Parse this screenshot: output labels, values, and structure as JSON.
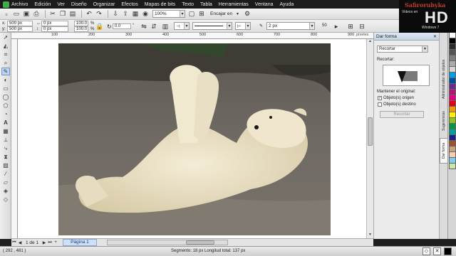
{
  "menubar": {
    "items": [
      "Archivo",
      "Edición",
      "Ver",
      "Diseño",
      "Organizar",
      "Efectos",
      "Mapas de bits",
      "Texto",
      "Tabla",
      "Herramientas",
      "Ventana",
      "Ayuda"
    ]
  },
  "std_toolbar": {
    "zoom": "100%",
    "snap": "Encajar en"
  },
  "property_bar": {
    "x": "500 px",
    "y": "500 px",
    "w": "0 px",
    "h": "0 px",
    "scale_w": "100.0",
    "scale_h": "100.0",
    "angle": "0.0",
    "outline_width": "2 px",
    "smoothing": "50"
  },
  "ruler": {
    "unit": "píxeles",
    "top_ticks": [
      "100",
      "200",
      "300",
      "400",
      "500",
      "600",
      "700",
      "800",
      "900"
    ]
  },
  "docker": {
    "title": "Dar forma",
    "mode": "Recortar",
    "section_label": "Recortar:",
    "keep_label": "Mantener el original:",
    "source_label": "Objeto(s) origen",
    "target_label": "Objeto(s) destino",
    "apply_label": "Recortar",
    "source_checked": true,
    "target_checked": false
  },
  "side_tabs": [
    "Administrador de objetos",
    "Sugerencias",
    "Dar forma"
  ],
  "palette": {
    "colors": [
      "#ffffff",
      "#000000",
      "#2b2b2b",
      "#555555",
      "#7f7f7f",
      "#aaaaaa",
      "#d4d4d4",
      "#00a0e9",
      "#0050a0",
      "#6a2c91",
      "#b0176e",
      "#e4007f",
      "#e60012",
      "#f39800",
      "#fff100",
      "#8fc31f",
      "#009944",
      "#00a29a",
      "#1d2088",
      "#a0522d",
      "#c8a27c",
      "#f5d0b0",
      "#7fcdee",
      "#c9e7a9"
    ]
  },
  "pagebar": {
    "page_count": "1 de 1",
    "page_tab": "Página 1"
  },
  "statusbar": {
    "coords": "( 292 , 481 )",
    "segment": "Segmento: 18 px Longitud total: 137 px"
  },
  "watermark": {
    "brand": "Safirorubyka",
    "sub": "Videos en",
    "hd": "HD",
    "os": "Windows 7"
  }
}
